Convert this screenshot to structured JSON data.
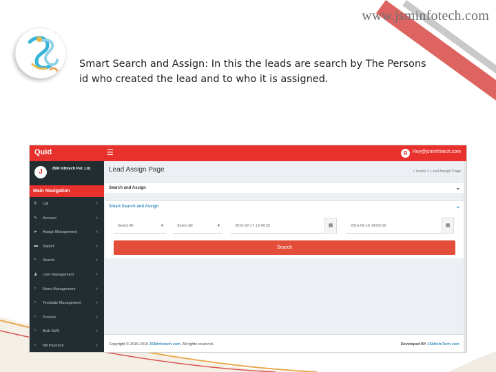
{
  "slide": {
    "site_url": "www.jsminfotech.com",
    "logo_text": "JS",
    "caption": "Smart Search and Assign: In this the leads are search by The Persons id who created the lead and to who it is assigned."
  },
  "app": {
    "brand": "Quid",
    "user_initial": "R",
    "user_email": "Roy@jsminfotech.com",
    "company_initial": "J",
    "company_name": "JSM Infotech Pvt. Ltd.",
    "nav_header": "Main Navigation",
    "nav_items": [
      {
        "label": "call",
        "icon": "phone-icon"
      },
      {
        "label": "Account",
        "icon": "edit-icon"
      },
      {
        "label": "Assign Management",
        "icon": "send-icon"
      },
      {
        "label": "Report",
        "icon": "folder-icon"
      },
      {
        "label": "Search",
        "icon": "search-icon"
      },
      {
        "label": "User Management",
        "icon": "users-icon"
      },
      {
        "label": "Menu Management",
        "icon": "circle-icon"
      },
      {
        "label": "Template Management",
        "icon": "circle-icon"
      },
      {
        "label": "Product",
        "icon": "circle-icon"
      },
      {
        "label": "Bulk SMS",
        "icon": "circle-icon"
      },
      {
        "label": "Bill Payment",
        "icon": "circle-icon"
      }
    ],
    "page_title": "Lead Assign Page",
    "breadcrumb": {
      "home": "Home",
      "current": "Lead Assign Page"
    },
    "box1_title": "Search and Assign",
    "box2_title": "Smart Search and Assign",
    "filters": {
      "select1": "Select All",
      "select2": "Select All",
      "date_from": "2015-02-17 13:49:33",
      "date_to": "2016-06-16 14:08:59"
    },
    "search_button": "Search",
    "footer": {
      "copyright": "Copyright © 2015-2016",
      "company_link": "JSMinfotech.com",
      "rights": ". All rights reserved.",
      "developed_by": "Developed BY",
      "dev_link": "JSMinfoTech.com"
    }
  },
  "colors": {
    "accent_red": "#e8312d",
    "sidebar_dark": "#222d32",
    "link_blue": "#3c8dbc"
  }
}
